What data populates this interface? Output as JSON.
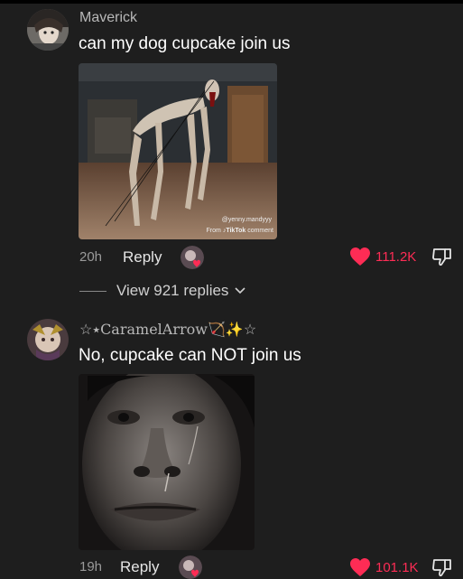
{
  "comments": [
    {
      "username": "Maverick",
      "text": "can my dog cupcake join us",
      "media_watermark_user": "@yenny.mandyyy",
      "media_watermark_from": "From",
      "media_watermark_app": "TikTok",
      "media_watermark_suffix": "comment",
      "time": "20h",
      "reply_label": "Reply",
      "likes": "111.2K",
      "liked": true,
      "view_replies": "View 921 replies"
    },
    {
      "username": "☆٭CaramelArrow🏹✨☆",
      "text": "No, cupcake can NOT join us",
      "time": "19h",
      "reply_label": "Reply",
      "likes": "101.1K",
      "liked": true
    }
  ],
  "colors": {
    "background": "#1e1e1e",
    "like": "#fe2c55",
    "muted": "#9a9a9a"
  },
  "icons": [
    "heart-icon",
    "dislike-icon",
    "chevron-down-icon",
    "creator-liked-avatar"
  ]
}
